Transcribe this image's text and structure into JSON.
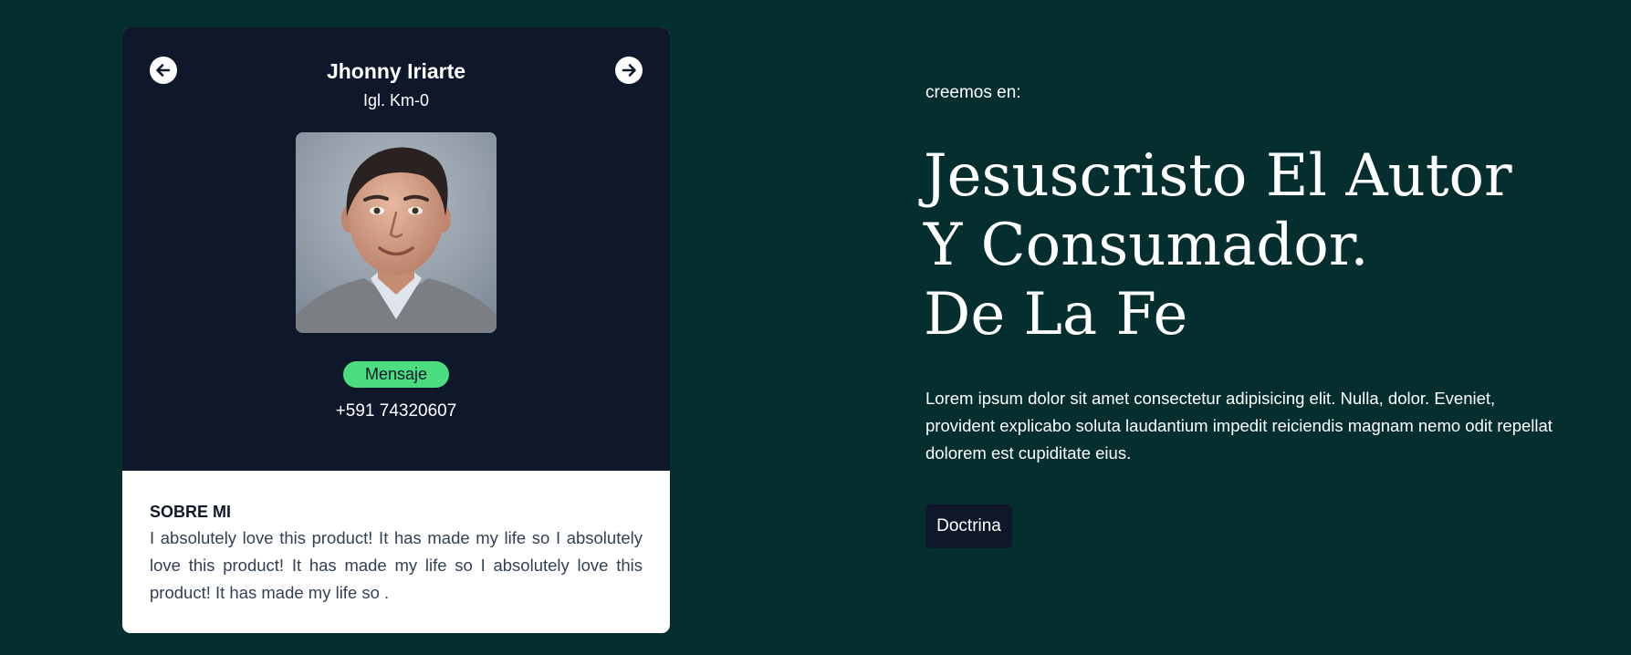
{
  "colors": {
    "page_background": "#042f2e",
    "card_dark": "#0f172a",
    "card_light": "#ffffff",
    "accent_green": "#4ade80",
    "button_dark": "#0f172a"
  },
  "profile_card": {
    "prev_icon": "arrow-left-circle-icon",
    "next_icon": "arrow-right-circle-icon",
    "name": "Jhonny Iriarte",
    "church": "Igl. Km-0",
    "message_button": "Mensaje",
    "phone": "+591 74320607",
    "about": {
      "title": "SOBRE MI",
      "text": "I absolutely love this product! It has made my life so I absolutely love this product! It has made my life so I absolutely love this product! It has made my life so ."
    }
  },
  "hero": {
    "eyebrow": "creemos en:",
    "title_lines": [
      "Jesuscristo El Autor",
      "Y Consumador.",
      "De La Fe"
    ],
    "body": "Lorem ipsum dolor sit amet consectetur adipisicing elit. Nulla, dolor. Eveniet, provident explicabo soluta laudantium impedit reiciendis magnam nemo odit repellat dolorem est cupiditate eius.",
    "button": "Doctrina"
  }
}
